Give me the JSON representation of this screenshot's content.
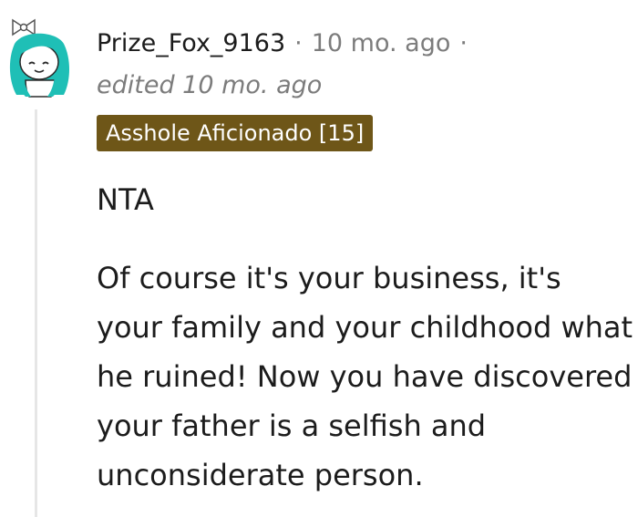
{
  "comment": {
    "username": "Prize_Fox_9163",
    "separator": "·",
    "posted": "10 mo. ago",
    "edited": "edited 10 mo. ago",
    "flair": "Asshole Aficionado [15]",
    "body": [
      "NTA",
      "Of course it's your business, it's your family and your childhood what he ruined! Now you have discovered your father is a selfish and unconsiderate person."
    ],
    "avatar_icon": "snoo-avatar-icon",
    "colors": {
      "flair_bg": "#6e5618",
      "avatar_hair": "#1fbfb6",
      "meta_text": "#7c7c7c"
    }
  }
}
